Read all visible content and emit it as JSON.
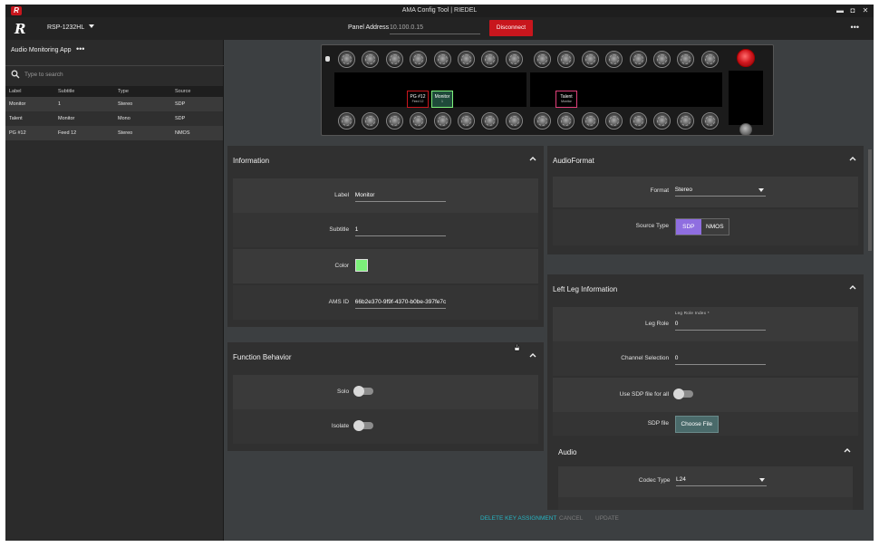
{
  "window": {
    "title": "AMA Config Tool | RIEDEL",
    "logo_letter": "R",
    "min": "▬",
    "max": "◘",
    "close": "✕"
  },
  "toolbar": {
    "logo": "R",
    "device": "RSP-1232HL",
    "panel_address_label": "Panel Address",
    "panel_address_value": "10.100.0.15",
    "disconnect_label": "Disconnect",
    "more": "•••"
  },
  "left_panel": {
    "title": "Audio Monitoring App",
    "more": "•••",
    "search_placeholder": "Type to search",
    "columns": [
      "Label",
      "Subtitle",
      "Type",
      "Source"
    ],
    "rows": [
      [
        "Monitor",
        "1",
        "Stereo",
        "SDP"
      ],
      [
        "Talent",
        "Monitor",
        "Mono",
        "SDP"
      ],
      [
        "PG #12",
        "Feed 12",
        "Stereo",
        "NMOS"
      ]
    ]
  },
  "panel_keys": {
    "key1": {
      "label": "PG #12",
      "sub": "Feed 12",
      "color": "#c8161d"
    },
    "key2": {
      "label": "Monitor",
      "sub": "1",
      "color": "#7cf07a"
    },
    "key3": {
      "label": "Talent",
      "sub": "Monitor",
      "color": "#e0407a"
    }
  },
  "information": {
    "title": "Information",
    "label_label": "Label",
    "label_value": "Monitor",
    "subtitle_label": "Subtitle",
    "subtitle_value": "1",
    "color_label": "Color",
    "color_value": "#7cf07a",
    "ams_label": "AMS ID",
    "ams_value": "66b2e370-9f9f-4370-b0be-397fe7c8"
  },
  "function_behavior": {
    "title": "Function Behavior",
    "solo_label": "Solo",
    "solo_on": false,
    "isolate_label": "Isolate",
    "isolate_on": false
  },
  "audio_format": {
    "title": "AudioFormat",
    "format_label": "Format",
    "format_value": "Stereo",
    "source_type_label": "Source Type",
    "source_options": [
      "SDP",
      "NMOS"
    ],
    "source_selected": "SDP"
  },
  "left_leg": {
    "title": "Left Leg Information",
    "leg_role_label": "Leg Role",
    "leg_role_field_title": "Leg Role Index *",
    "leg_role_value": "0",
    "channel_label": "Channel Selection",
    "channel_value": "0",
    "use_sdp_label": "Use SDP file for all",
    "use_sdp_on": false,
    "sdp_file_label": "SDP file",
    "choose_file_label": "Choose File"
  },
  "audio": {
    "title": "Audio",
    "codec_label": "Codec Type",
    "codec_value": "L24"
  },
  "footer": {
    "delete_label": "DELETE KEY ASSIGNMENT",
    "cancel_label": "CANCEL",
    "update_label": "UPDATE",
    "accent": "#26b5c3"
  }
}
